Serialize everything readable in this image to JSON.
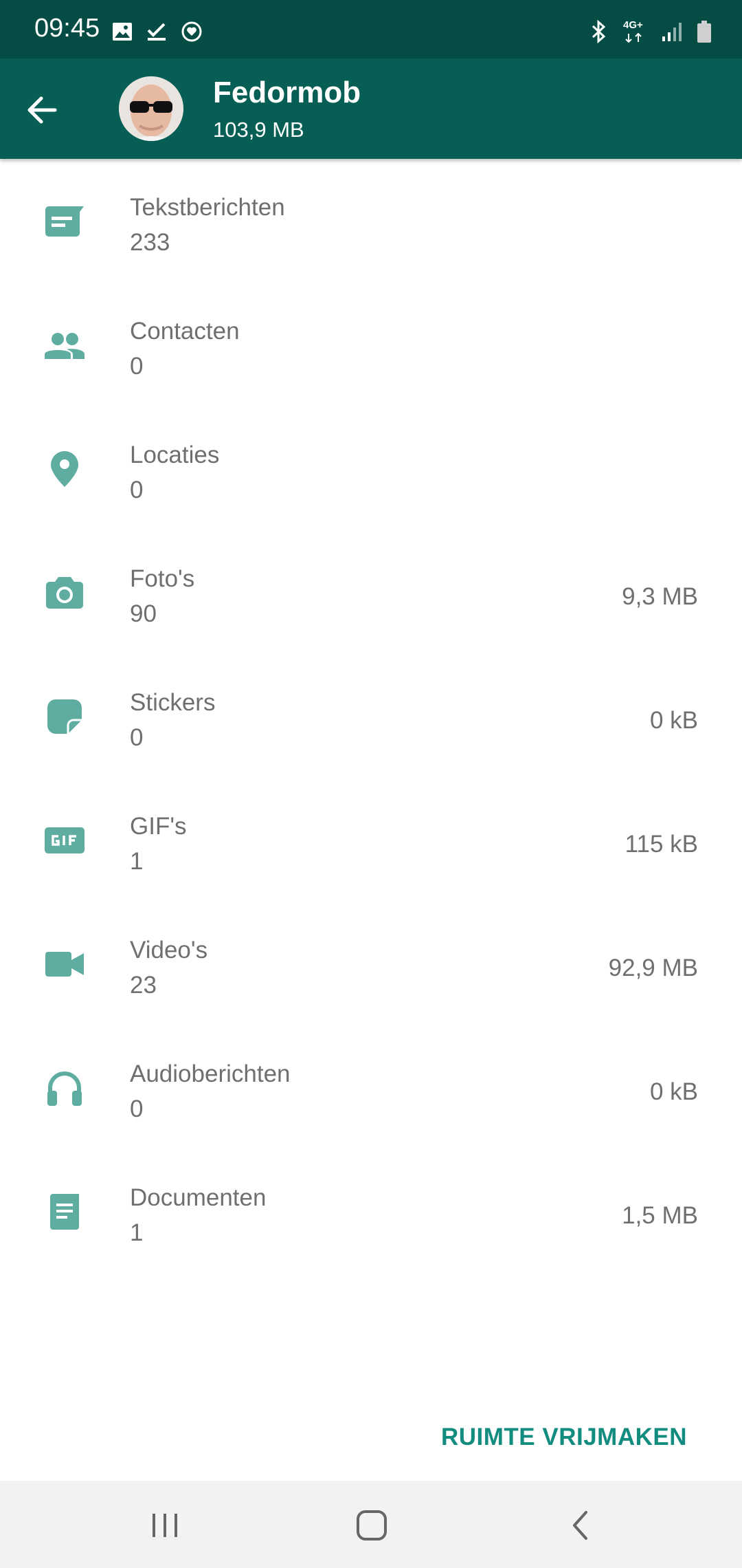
{
  "status_bar": {
    "time": "09:45",
    "network": "4G+",
    "icons_left": [
      "gallery-icon",
      "check-icon",
      "heart-circle-icon"
    ],
    "icons_right": [
      "bluetooth-icon",
      "network-4g-icon",
      "signal-icon",
      "battery-icon"
    ]
  },
  "app_bar": {
    "back_icon": "arrow-left-icon",
    "name": "Fedormob",
    "size": "103,9 MB"
  },
  "items": [
    {
      "icon": "message-icon",
      "label": "Tekstberichten",
      "count": "233",
      "size": ""
    },
    {
      "icon": "people-icon",
      "label": "Contacten",
      "count": "0",
      "size": ""
    },
    {
      "icon": "location-pin-icon",
      "label": "Locaties",
      "count": "0",
      "size": ""
    },
    {
      "icon": "camera-icon",
      "label": "Foto's",
      "count": "90",
      "size": "9,3 MB"
    },
    {
      "icon": "sticker-icon",
      "label": "Stickers",
      "count": "0",
      "size": "0 kB"
    },
    {
      "icon": "gif-icon",
      "label": "GIF's",
      "count": "1",
      "size": "115 kB"
    },
    {
      "icon": "video-camera-icon",
      "label": "Video's",
      "count": "23",
      "size": "92,9 MB"
    },
    {
      "icon": "headphones-icon",
      "label": "Audioberichten",
      "count": "0",
      "size": "0 kB"
    },
    {
      "icon": "document-icon",
      "label": "Documenten",
      "count": "1",
      "size": "1,5 MB"
    }
  ],
  "free_space_button": "RUIMTE VRIJMAKEN",
  "nav_bar": {
    "icons": [
      "recent-apps-icon",
      "home-icon",
      "back-icon"
    ]
  },
  "colors": {
    "status_bar": "#054d44",
    "app_bar": "#075e54",
    "accent": "#128c7e",
    "icon": "#5fada0",
    "text_secondary": "#6f6f6f",
    "nav_bar": "#f2f2f2"
  }
}
